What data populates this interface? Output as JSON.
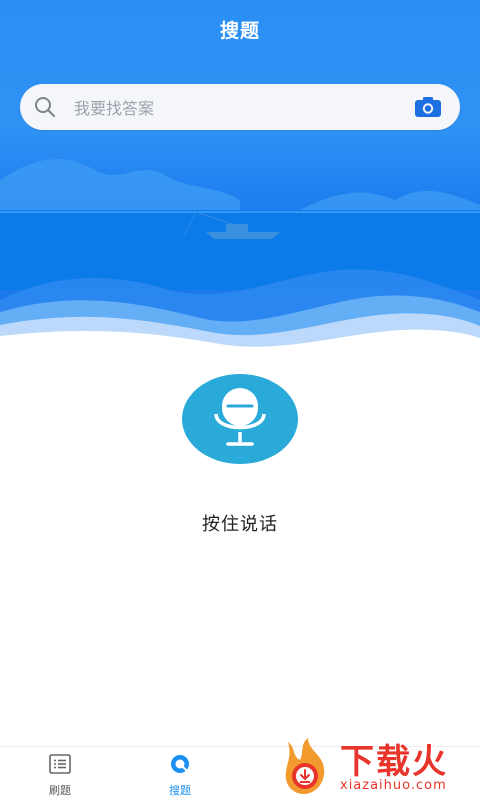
{
  "header": {
    "title": "搜题"
  },
  "search": {
    "placeholder": "我要找答案"
  },
  "voice": {
    "hold_label": "按住说话"
  },
  "tabbar": {
    "items": [
      {
        "label": "刷题",
        "icon": "list-icon",
        "active": false
      },
      {
        "label": "搜题",
        "icon": "search-tab-icon",
        "active": true
      }
    ]
  },
  "watermark": {
    "brand": "下载火",
    "domain": "xiazaihuo.com"
  },
  "colors": {
    "primary": "#1C8FF0",
    "mic_bg": "#2AAAD8",
    "hero_top": "#2A8FF3",
    "watermark_red": "#E8342B"
  }
}
